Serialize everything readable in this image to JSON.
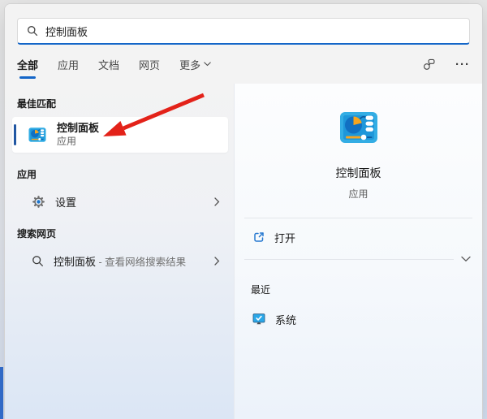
{
  "colors": {
    "accent_blue": "#1466c8",
    "selection_bar": "#2157a3",
    "arrow_red": "#e32219",
    "icon_panel_frame": "#33ade4",
    "icon_panel_inner": "#1e97da",
    "icon_pie": "#1170c2",
    "icon_orange": "#f7a51f"
  },
  "search": {
    "value": "控制面板",
    "icon": "search-icon"
  },
  "tabs": {
    "items": [
      {
        "label": "全部",
        "active": true
      },
      {
        "label": "应用",
        "active": false
      },
      {
        "label": "文档",
        "active": false
      },
      {
        "label": "网页",
        "active": false
      },
      {
        "label": "更多",
        "active": false,
        "has_dropdown": true
      }
    ],
    "trailing_icons": [
      "account-icon",
      "ellipsis-icon"
    ],
    "ellipsis_glyph": "···"
  },
  "left": {
    "best_match": {
      "header": "最佳匹配",
      "item": {
        "title": "控制面板",
        "subtitle": "应用",
        "icon": "control-panel-icon"
      }
    },
    "apps": {
      "header": "应用",
      "items": [
        {
          "label": "设置",
          "icon": "gear-icon"
        }
      ]
    },
    "web": {
      "header": "搜索网页",
      "item": {
        "query": "控制面板",
        "suffix": " - 查看网络搜索结果",
        "icon": "search-icon"
      }
    }
  },
  "right": {
    "app_title": "控制面板",
    "app_subtitle": "应用",
    "app_icon": "control-panel-icon",
    "actions": [
      {
        "label": "打开",
        "icon": "open-external-icon"
      }
    ],
    "recent": {
      "header": "最近",
      "items": [
        {
          "label": "系统",
          "icon": "monitor-icon"
        }
      ]
    }
  },
  "annotation": {
    "type": "red-arrow",
    "points_to": "best-match-item"
  }
}
